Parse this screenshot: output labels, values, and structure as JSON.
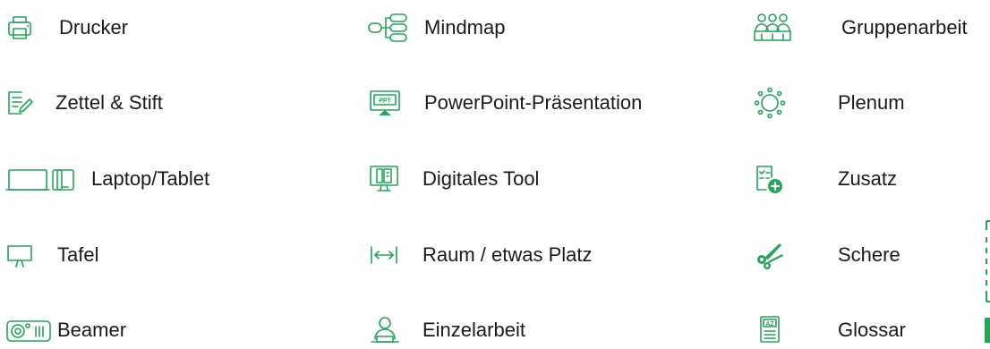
{
  "legend": {
    "col1": [
      {
        "label": "Drucker",
        "icon": "printer-icon"
      },
      {
        "label": "Zettel & Stift",
        "icon": "paper-pen-icon"
      },
      {
        "label": "Laptop/Tablet",
        "icon": "laptop-tablet-icon"
      },
      {
        "label": "Tafel",
        "icon": "board-icon"
      },
      {
        "label": "Beamer",
        "icon": "projector-icon"
      }
    ],
    "col2": [
      {
        "label": "Mindmap",
        "icon": "mindmap-icon"
      },
      {
        "label": "PowerPoint-Präsentation",
        "icon": "presentation-icon"
      },
      {
        "label": "Digitales Tool",
        "icon": "digital-tool-icon"
      },
      {
        "label": "Raum / etwas Platz",
        "icon": "space-icon"
      },
      {
        "label": "Einzelarbeit",
        "icon": "single-work-icon"
      }
    ],
    "col3": [
      {
        "label": "Gruppenarbeit",
        "icon": "group-work-icon"
      },
      {
        "label": "Plenum",
        "icon": "plenum-icon"
      },
      {
        "label": "Zusatz",
        "icon": "extra-icon"
      },
      {
        "label": "Schere",
        "icon": "scissors-icon"
      },
      {
        "label": "Glossar",
        "icon": "glossary-icon"
      }
    ]
  },
  "ppt_text": "PPT",
  "glossary_text": "AZ",
  "colors": {
    "accent": "#27a35a",
    "text": "#1a1a1a"
  }
}
